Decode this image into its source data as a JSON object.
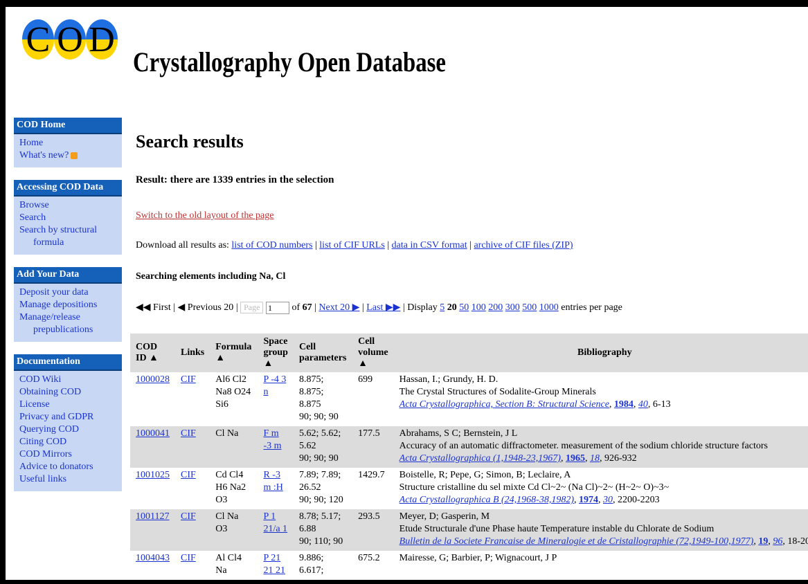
{
  "header": {
    "logo_letters": [
      "C",
      "O",
      "D"
    ],
    "title": "Crystallography Open Database"
  },
  "sidebar": [
    {
      "title": "COD Home",
      "items": [
        {
          "label": "Home"
        },
        {
          "label": "What's new?"
        }
      ]
    },
    {
      "title": "Accessing COD Data",
      "items": [
        {
          "label": "Browse"
        },
        {
          "label": "Search"
        },
        {
          "label": "Search by structural"
        },
        {
          "label": "formula"
        }
      ]
    },
    {
      "title": "Add Your Data",
      "items": [
        {
          "label": "Deposit your data"
        },
        {
          "label": "Manage depositions"
        },
        {
          "label": "Manage/release"
        },
        {
          "label": "prepublications"
        }
      ]
    },
    {
      "title": "Documentation",
      "items": [
        {
          "label": "COD Wiki"
        },
        {
          "label": "Obtaining COD"
        },
        {
          "label": "License"
        },
        {
          "label": "Privacy and GDPR"
        },
        {
          "label": "Querying COD"
        },
        {
          "label": "Citing COD"
        },
        {
          "label": "COD Mirrors"
        },
        {
          "label": "Advice to donators"
        },
        {
          "label": "Useful links"
        }
      ]
    }
  ],
  "main": {
    "heading": "Search results",
    "result_line": "Result: there are 1339 entries in the selection",
    "old_layout_link": "Switch to the old layout of the page",
    "downloads": {
      "prefix": "Download all results as:",
      "links": [
        "list of COD numbers",
        "list of CIF URLs",
        "data in CSV format",
        "archive of CIF files (ZIP)"
      ]
    },
    "search_elements": "Searching elements including Na, Cl",
    "pager": {
      "first": "◀◀ First",
      "previous": "◀ Previous 20",
      "page_label": "Page",
      "page_value": "1",
      "of": "of",
      "total_pages": "67",
      "next": "Next 20 ▶",
      "last": "Last ▶▶",
      "display": "Display",
      "sizes": [
        "5",
        "20",
        "50",
        "100",
        "200",
        "300",
        "500",
        "1000"
      ],
      "current_size": "20",
      "suffix": "entries per page"
    },
    "table": {
      "headers": [
        "COD ID ▲",
        "Links",
        "Formula ▲",
        "Space group ▲",
        "Cell parameters",
        "Cell volume ▲",
        "Bibliography"
      ],
      "rows": [
        {
          "id": "1000028",
          "link": "CIF",
          "formula": "Al6 Cl2 Na8 O24 Si6",
          "space_group": "P -4 3 n",
          "cell": "8.875; 8.875; 8.875",
          "angles": "90; 90; 90",
          "volume": "699",
          "authors": "Hassan, I.; Grundy, H. D.",
          "title": "The Crystal Structures of Sodalite-Group Minerals",
          "journal": "Acta Crystallographica, Section B: Structural Science",
          "year": "1984",
          "volume_no": "40",
          "pages": ", 6-13"
        },
        {
          "id": "1000041",
          "link": "CIF",
          "formula": "Cl Na",
          "space_group": "F m -3 m",
          "cell": "5.62; 5.62; 5.62",
          "angles": "90; 90; 90",
          "volume": "177.5",
          "authors": "Abrahams, S C; Bernstein, J L",
          "title": "Accuracy of an automatic diffractometer. measurement of the sodium chloride structure factors",
          "journal": "Acta Crystallographica (1,1948-23,1967)",
          "year": "1965",
          "volume_no": "18",
          "pages": ", 926-932"
        },
        {
          "id": "1001025",
          "link": "CIF",
          "formula": "Cd Cl4 H6 Na2 O3",
          "space_group": "R -3 m :H",
          "cell": "7.89; 7.89; 26.52",
          "angles": "90; 90; 120",
          "volume": "1429.7",
          "authors": "Boistelle, R; Pepe, G; Simon, B; Leclaire, A",
          "title": "Structure cristalline du sel mixte Cd Cl~2~ (Na Cl)~2~ (H~2~ O)~3~",
          "journal": "Acta Crystallographica B (24,1968-38,1982)",
          "year": "1974",
          "volume_no": "30",
          "pages": ", 2200-2203"
        },
        {
          "id": "1001127",
          "link": "CIF",
          "formula": "Cl Na O3",
          "space_group": "P 1 21/a 1",
          "cell": "8.78; 5.17; 6.88",
          "angles": "90; 110; 90",
          "volume": "293.5",
          "authors": "Meyer, D; Gasperin, M",
          "title": "Etude Structurale d'une Phase haute Temperature instable du Chlorate de Sodium",
          "journal": "Bulletin de la Societe Francaise de Mineralogie et de Cristallographie (72,1949-100,1977)",
          "year": "19",
          "volume_no": "96",
          "pages": ", 18-20"
        },
        {
          "id": "1004043",
          "link": "CIF",
          "formula": "Al Cl4 Na",
          "space_group": "P 21 21 21",
          "cell": "9.886; 6.617;",
          "angles": "",
          "volume": "675.2",
          "authors": "Mairesse, G; Barbier, P; Wignacourt, J P",
          "title": "",
          "journal": "",
          "year": "",
          "volume_no": "",
          "pages": ""
        }
      ]
    }
  }
}
